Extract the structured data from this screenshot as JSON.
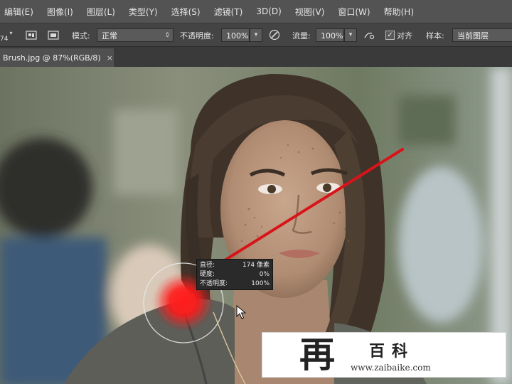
{
  "menubar": {
    "items": [
      "编辑(E)",
      "图像(I)",
      "图层(L)",
      "类型(Y)",
      "选择(S)",
      "滤镜(T)",
      "3D(D)",
      "视图(V)",
      "窗口(W)",
      "帮助(H)"
    ]
  },
  "options": {
    "brush_size_fragment": "74",
    "mode_label": "模式:",
    "mode_value": "正常",
    "opacity_label": "不透明度:",
    "opacity_value": "100%",
    "flow_label": "流量:",
    "flow_value": "100%",
    "align_label": "对齐",
    "align_checked": true,
    "sample_label": "样本:",
    "sample_value": "当前图层"
  },
  "document": {
    "tab_label": "Brush.jpg @ 87%(RGB/8)",
    "close_glyph": "×"
  },
  "tooltip": {
    "rows": [
      {
        "label": "直径:",
        "value": "174 像素"
      },
      {
        "label": "硬度:",
        "value": "0%"
      },
      {
        "label": "不透明度:",
        "value": "100%"
      }
    ]
  },
  "watermark": {
    "glyph": "再",
    "brand": "百科",
    "url": "www.zaibaike.com"
  },
  "colors": {
    "menubar_bg": "#535353",
    "options_bg": "#444444",
    "brush_red": "#ff1a1a",
    "arrow_red": "#d8141a"
  },
  "icons": [
    "brush-preset-icon",
    "clone-source-icon",
    "toggle-panel-icon",
    "pressure-opacity-icon",
    "airbrush-icon",
    "pressure-size-icon",
    "checkbox-icon",
    "arrow-cursor-icon"
  ]
}
